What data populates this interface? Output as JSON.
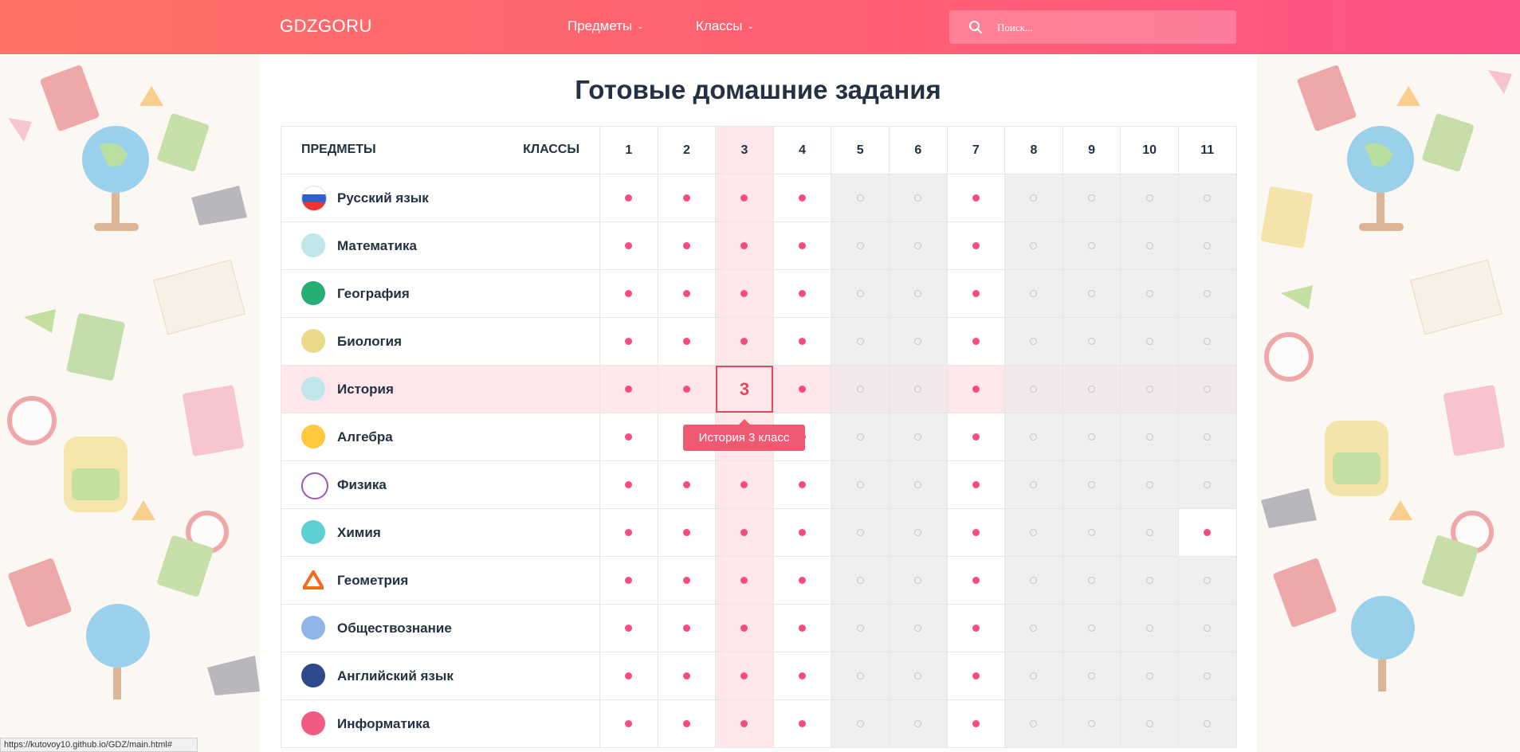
{
  "header": {
    "logo": "GDZGORU",
    "nav": [
      {
        "label": "Предметы",
        "chevron": "chevron-down-icon"
      },
      {
        "label": "Классы",
        "chevron": "chevron-down-icon"
      }
    ],
    "search": {
      "placeholder": "Поиск...",
      "icon": "search-icon"
    }
  },
  "page": {
    "title": "Готовые домашние задания"
  },
  "table": {
    "subjects_header": "ПРЕДМЕТЫ",
    "classes_header": "КЛАССЫ",
    "grades": [
      "1",
      "2",
      "3",
      "4",
      "5",
      "6",
      "7",
      "8",
      "9",
      "10",
      "11"
    ],
    "highlighted_grade": "3",
    "rows": [
      {
        "subject": "Русский язык",
        "icon": "russia-flag-icon",
        "avail": [
          1,
          1,
          1,
          1,
          0,
          0,
          1,
          0,
          0,
          0,
          0
        ]
      },
      {
        "subject": "Математика",
        "icon": "math-book-icon",
        "avail": [
          1,
          1,
          1,
          1,
          0,
          0,
          1,
          0,
          0,
          0,
          0
        ]
      },
      {
        "subject": "География",
        "icon": "globe-icon",
        "avail": [
          1,
          1,
          1,
          1,
          0,
          0,
          1,
          0,
          0,
          0,
          0
        ]
      },
      {
        "subject": "Биология",
        "icon": "biology-icon",
        "avail": [
          1,
          1,
          1,
          1,
          0,
          0,
          1,
          0,
          0,
          0,
          0
        ]
      },
      {
        "subject": "История",
        "icon": "history-book-icon",
        "avail": [
          1,
          1,
          1,
          1,
          0,
          0,
          1,
          0,
          0,
          0,
          0
        ]
      },
      {
        "subject": "Алгебра",
        "icon": "calculator-icon",
        "avail": [
          1,
          1,
          1,
          1,
          0,
          0,
          1,
          0,
          0,
          0,
          0
        ]
      },
      {
        "subject": "Физика",
        "icon": "atom-icon",
        "avail": [
          1,
          1,
          1,
          1,
          0,
          0,
          1,
          0,
          0,
          0,
          0
        ]
      },
      {
        "subject": "Химия",
        "icon": "flask-icon",
        "avail": [
          1,
          1,
          1,
          1,
          0,
          0,
          1,
          0,
          0,
          0,
          1
        ]
      },
      {
        "subject": "Геометрия",
        "icon": "triangle-icon",
        "avail": [
          1,
          1,
          1,
          1,
          0,
          0,
          1,
          0,
          0,
          0,
          0
        ]
      },
      {
        "subject": "Обществознание",
        "icon": "people-icon",
        "avail": [
          1,
          1,
          1,
          1,
          0,
          0,
          1,
          0,
          0,
          0,
          0
        ]
      },
      {
        "subject": "Английский язык",
        "icon": "uk-flag-icon",
        "avail": [
          1,
          1,
          1,
          1,
          0,
          0,
          1,
          0,
          0,
          0,
          0
        ]
      },
      {
        "subject": "Информатика",
        "icon": "computer-icon",
        "avail": [
          1,
          1,
          1,
          1,
          0,
          0,
          1,
          0,
          0,
          0,
          0
        ]
      }
    ],
    "active_cell": {
      "row": 4,
      "grade": 3,
      "text": "3"
    },
    "tooltip": "История 3 класс"
  },
  "status_url": "https://kutovoy10.github.io/GDZ/main.html#",
  "colors": {
    "accent": "#f84c7c",
    "header_from": "#ff7166",
    "header_to": "#fc5286",
    "title": "#233142"
  }
}
